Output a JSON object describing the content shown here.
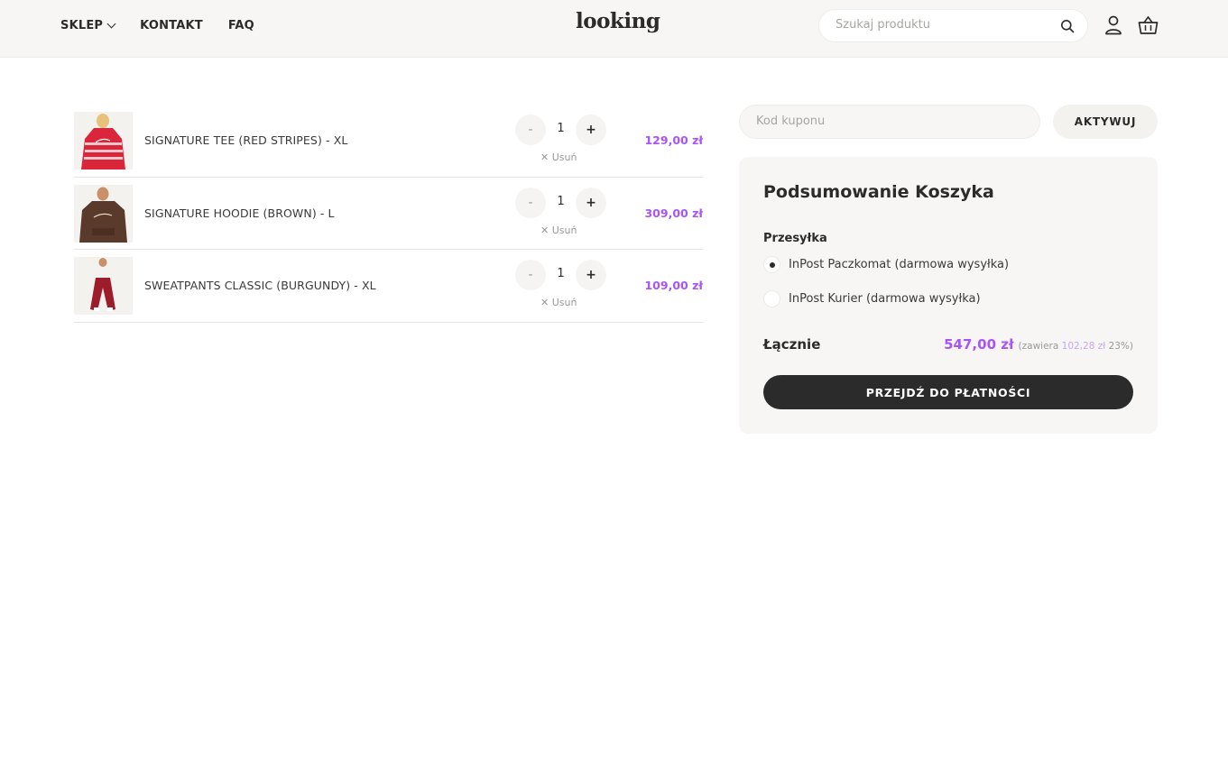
{
  "nav": {
    "shop": "SKLEP",
    "contact": "KONTAKT",
    "faq": "FAQ"
  },
  "brand": {
    "logo": "looking"
  },
  "search": {
    "placeholder": "Szukaj produktu",
    "value": ""
  },
  "icons": {
    "search": "search-icon",
    "user": "user-icon",
    "cart": "basket-icon",
    "remove": "close-icon",
    "chevron": "chevron-down-icon"
  },
  "colors": {
    "accent": "#a855f7",
    "dark": "#2b2b2b",
    "panel": "#f7f6f4"
  },
  "cart": {
    "items": [
      {
        "name": "SIGNATURE TEE (RED STRIPES) - XL",
        "qty": "1",
        "price": "129,00 zł",
        "minus": "-",
        "plus": "+",
        "remove": "Usuń"
      },
      {
        "name": "SIGNATURE HOODIE (BROWN) - L",
        "qty": "1",
        "price": "309,00 zł",
        "minus": "-",
        "plus": "+",
        "remove": "Usuń"
      },
      {
        "name": "SWEATPANTS CLASSIC (BURGUNDY) - XL",
        "qty": "1",
        "price": "109,00 zł",
        "minus": "-",
        "plus": "+",
        "remove": "Usuń"
      }
    ]
  },
  "coupon": {
    "placeholder": "Kod kuponu",
    "value": "",
    "button": "AKTYWUJ"
  },
  "summary": {
    "title": "Podsumowanie Koszyka",
    "shipping_label": "Przesyłka",
    "options": [
      {
        "label": "InPost Paczkomat (darmowa wysyłka)",
        "selected": true
      },
      {
        "label": "InPost Kurier (darmowa wysyłka)",
        "selected": false
      }
    ],
    "total_label": "Łącznie",
    "total_value": "547,00 zł",
    "tax_prefix": "(zawiera",
    "tax_value": "102,28 zł",
    "tax_suffix": "23%)",
    "checkout": "PRZEJDŹ DO PŁATNOŚCI"
  }
}
